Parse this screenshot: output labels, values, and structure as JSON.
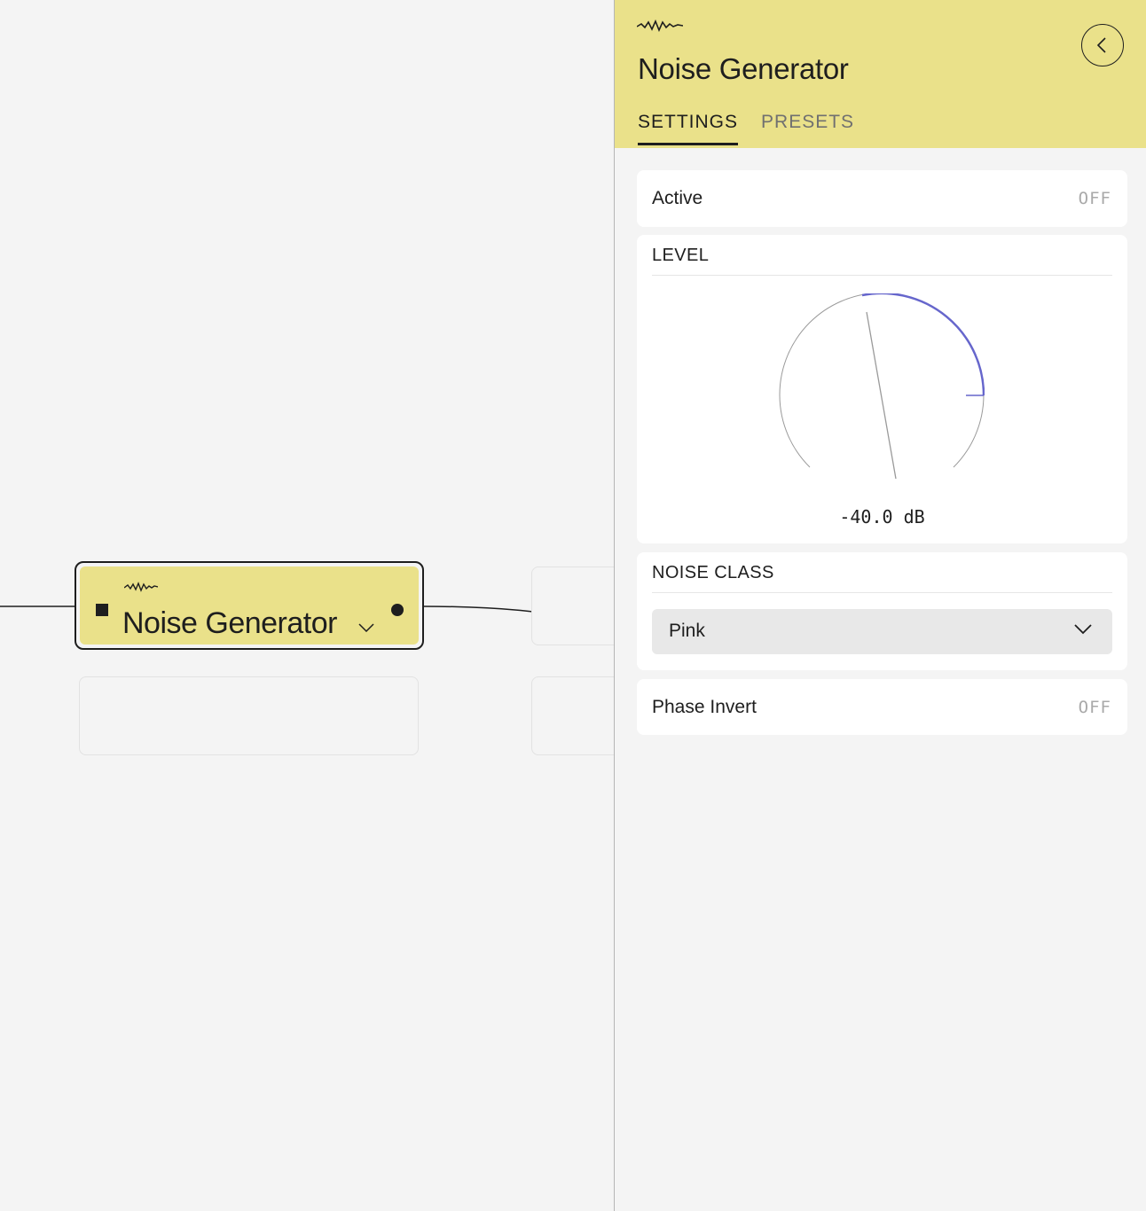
{
  "canvas": {
    "node": {
      "title": "Noise Generator",
      "icon": "noise-wave-icon"
    }
  },
  "panel": {
    "icon": "noise-wave-icon",
    "title": "Noise Generator",
    "back_icon": "chevron-left-icon",
    "tabs": [
      {
        "label": "SETTINGS",
        "active": true
      },
      {
        "label": "PRESETS",
        "active": false
      }
    ],
    "active": {
      "label": "Active",
      "value": "OFF"
    },
    "level": {
      "label": "LEVEL",
      "value": "-40.0 dB"
    },
    "noise_class": {
      "label": "NOISE CLASS",
      "selected": "Pink"
    },
    "phase_invert": {
      "label": "Phase Invert",
      "value": "OFF"
    }
  },
  "colors": {
    "accent_yellow": "#eae18a",
    "knob_arc": "#6666cc",
    "text": "#1e1e1e",
    "muted_value": "#a9a9a9"
  }
}
